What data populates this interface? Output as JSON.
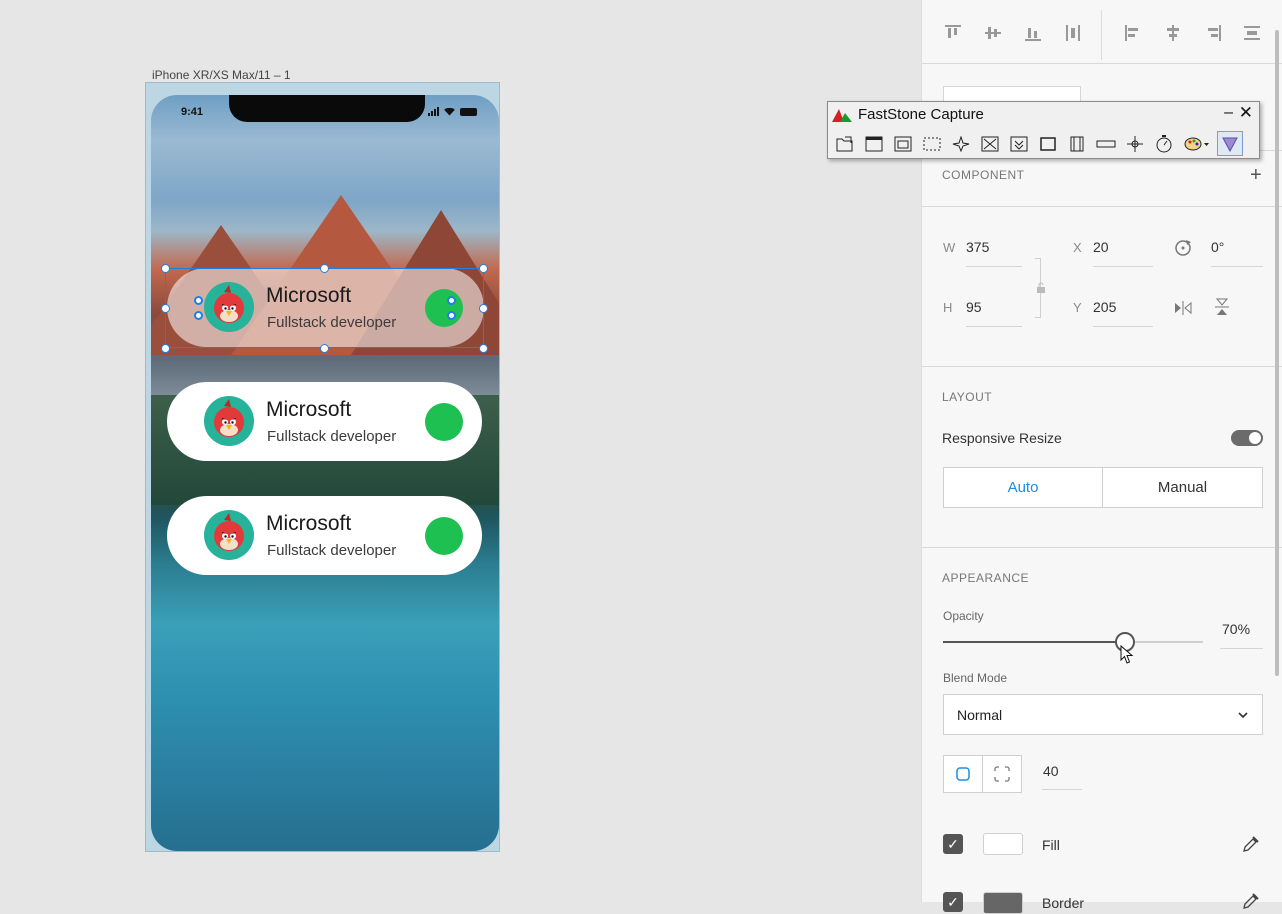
{
  "artboard": {
    "label": "iPhone XR/XS Max/11 – 1",
    "status_time": "9:41"
  },
  "cards": [
    {
      "title": "Microsoft",
      "subtitle": "Fullstack developer",
      "selected": true
    },
    {
      "title": "Microsoft",
      "subtitle": "Fullstack developer",
      "selected": false
    },
    {
      "title": "Microsoft",
      "subtitle": "Fullstack developer",
      "selected": false
    }
  ],
  "faststone": {
    "title": "FastStone Capture",
    "minimize": "–",
    "close": "✕"
  },
  "panel": {
    "component_heading": "COMPONENT",
    "add_symbol": "+",
    "w_label": "W",
    "w_value": "375",
    "h_label": "H",
    "h_value": "95",
    "x_label": "X",
    "x_value": "20",
    "y_label": "Y",
    "y_value": "205",
    "rotation_value": "0°",
    "layout_heading": "LAYOUT",
    "responsive_resize_label": "Responsive Resize",
    "responsive_resize_on": true,
    "auto_label": "Auto",
    "manual_label": "Manual",
    "appearance_heading": "APPEARANCE",
    "opacity_label": "Opacity",
    "opacity_value": "70%",
    "opacity_fraction": 0.7,
    "blend_mode_label": "Blend Mode",
    "blend_mode_value": "Normal",
    "corner_radius_value": "40",
    "fill_label": "Fill",
    "border_label": "Border"
  },
  "colors": {
    "selection": "#1e80e6",
    "status_dot": "#1ec051",
    "avatar_bg": "#26b39a",
    "accent_text": "#1a8ee6"
  }
}
